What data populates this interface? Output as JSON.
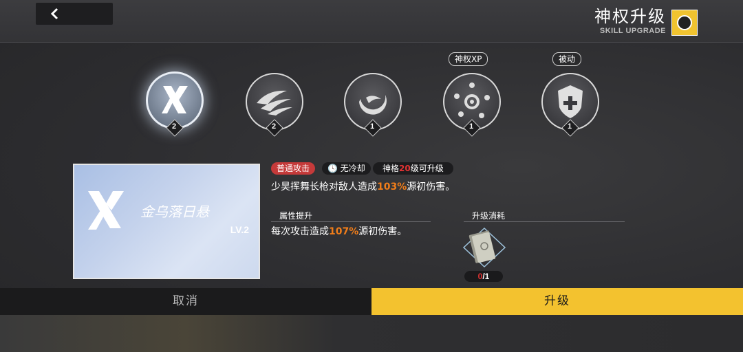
{
  "header": {
    "title_cn": "神权升级",
    "title_en": "SKILL UPGRADE"
  },
  "skills": [
    {
      "name": "skill-x",
      "level": "2",
      "tag": ""
    },
    {
      "name": "skill-claw",
      "level": "2",
      "tag": ""
    },
    {
      "name": "skill-crescent",
      "level": "1",
      "tag": ""
    },
    {
      "name": "skill-burst",
      "level": "1",
      "tag": "神权XP"
    },
    {
      "name": "skill-shield",
      "level": "1",
      "tag": "被动"
    }
  ],
  "card": {
    "name": "金乌落日悬",
    "level": "LV.2"
  },
  "chips": {
    "type": "普通攻击",
    "cooldown": "无冷却",
    "req_prefix": "神格",
    "req_num": "20",
    "req_suffix": "级可升级"
  },
  "description": {
    "prefix": "少昊挥舞长枪对敌人造成",
    "value": "103%",
    "suffix": "源初伤害。"
  },
  "attr_section": {
    "title": "属性提升",
    "prefix": "每次攻击造成",
    "value": "107%",
    "suffix": "源初伤害。"
  },
  "cost_section": {
    "title": "升级消耗",
    "have": "0",
    "need": "/1"
  },
  "buttons": {
    "cancel": "取消",
    "upgrade": "升级"
  },
  "colors": {
    "accent_yellow": "#f3c22f",
    "highlight_orange": "#f07d1a",
    "tag_red": "#c53a3a"
  }
}
